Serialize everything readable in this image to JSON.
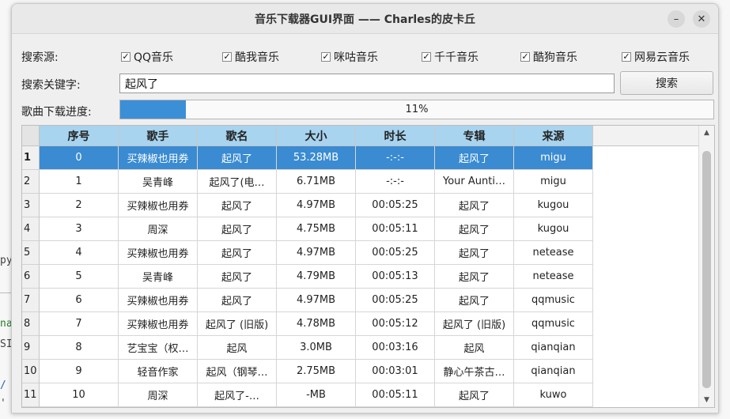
{
  "window": {
    "title": "音乐下载器GUI界面 —— Charles的皮卡丘"
  },
  "background": {
    "left_snippets": [
      "py",
      "na",
      "SI",
      "/",
      "'"
    ]
  },
  "form": {
    "source_label": "搜索源:",
    "sources": [
      {
        "label": "QQ音乐",
        "checked": true
      },
      {
        "label": "酷我音乐",
        "checked": true
      },
      {
        "label": "咪咕音乐",
        "checked": true
      },
      {
        "label": "千千音乐",
        "checked": true
      },
      {
        "label": "酷狗音乐",
        "checked": true
      },
      {
        "label": "网易云音乐",
        "checked": true
      }
    ],
    "keyword_label": "搜索关键字:",
    "keyword_value": "起风了",
    "search_button": "搜索",
    "progress_label": "歌曲下载进度:",
    "progress_percent": 11,
    "progress_text": "11%"
  },
  "table": {
    "columns": [
      "序号",
      "歌手",
      "歌名",
      "大小",
      "时长",
      "专辑",
      "来源"
    ],
    "selected_row": 0,
    "rows": [
      {
        "num": "1",
        "cells": [
          "0",
          "买辣椒也用券",
          "起风了",
          "53.28MB",
          "-:-:-",
          "起风了",
          "migu"
        ]
      },
      {
        "num": "2",
        "cells": [
          "1",
          "吴青峰",
          "起风了(电…",
          "6.71MB",
          "-:-:-",
          "Your Aunti…",
          "migu"
        ]
      },
      {
        "num": "3",
        "cells": [
          "2",
          "买辣椒也用券",
          "起风了",
          "4.97MB",
          "00:05:25",
          "起风了",
          "kugou"
        ]
      },
      {
        "num": "4",
        "cells": [
          "3",
          "周深",
          "起风了",
          "4.75MB",
          "00:05:11",
          "起风了",
          "kugou"
        ]
      },
      {
        "num": "5",
        "cells": [
          "4",
          "买辣椒也用券",
          "起风了",
          "4.97MB",
          "00:05:25",
          "起风了",
          "netease"
        ]
      },
      {
        "num": "6",
        "cells": [
          "5",
          "吴青峰",
          "起风了",
          "4.79MB",
          "00:05:13",
          "起风了",
          "netease"
        ]
      },
      {
        "num": "7",
        "cells": [
          "6",
          "买辣椒也用券",
          "起风了",
          "4.97MB",
          "00:05:25",
          "起风了",
          "qqmusic"
        ]
      },
      {
        "num": "8",
        "cells": [
          "7",
          "买辣椒也用券",
          "起风了 (旧版)",
          "4.78MB",
          "00:05:12",
          "起风了 (旧版)",
          "qqmusic"
        ]
      },
      {
        "num": "9",
        "cells": [
          "8",
          "艺宝宝（权…",
          "起风",
          "3.0MB",
          "00:03:16",
          "起风",
          "qianqian"
        ]
      },
      {
        "num": "10",
        "cells": [
          "9",
          "轻音作家",
          "起风（钢琴…",
          "2.75MB",
          "00:03:01",
          "静心午茶古…",
          "qianqian"
        ]
      },
      {
        "num": "11",
        "cells": [
          "10",
          "周深",
          "起风了-…",
          "-MB",
          "00:05:11",
          "起风了",
          "kuwo"
        ]
      }
    ]
  }
}
